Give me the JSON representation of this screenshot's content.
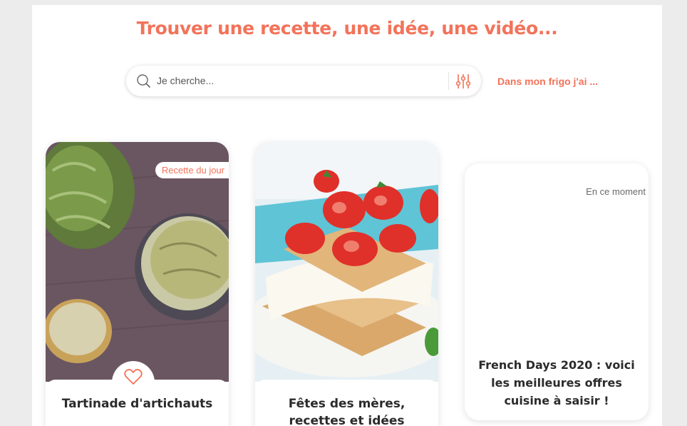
{
  "header": {
    "headline": "Trouver une recette, une idée, une vidéo..."
  },
  "search": {
    "placeholder": "Je cherche...",
    "value": ""
  },
  "frigo_link": "Dans mon frigo j'ai ...",
  "cards": [
    {
      "tag": "Recette du jour",
      "title": "Tartinade d'artichauts",
      "image": "artichoke-spread-photo"
    },
    {
      "tag": "",
      "title": "Fêtes des mères, recettes et idées",
      "image": "strawberry-tiramisu-photo"
    },
    {
      "tag": "En ce moment",
      "title": "French Days 2020 : voici les meilleures offres cuisine à saisir !"
    }
  ],
  "colors": {
    "accent": "#f2735a",
    "background": "#ececec",
    "text": "#2b2b2b"
  },
  "icons": [
    "search-icon",
    "filter-sliders-icon",
    "heart-icon"
  ]
}
